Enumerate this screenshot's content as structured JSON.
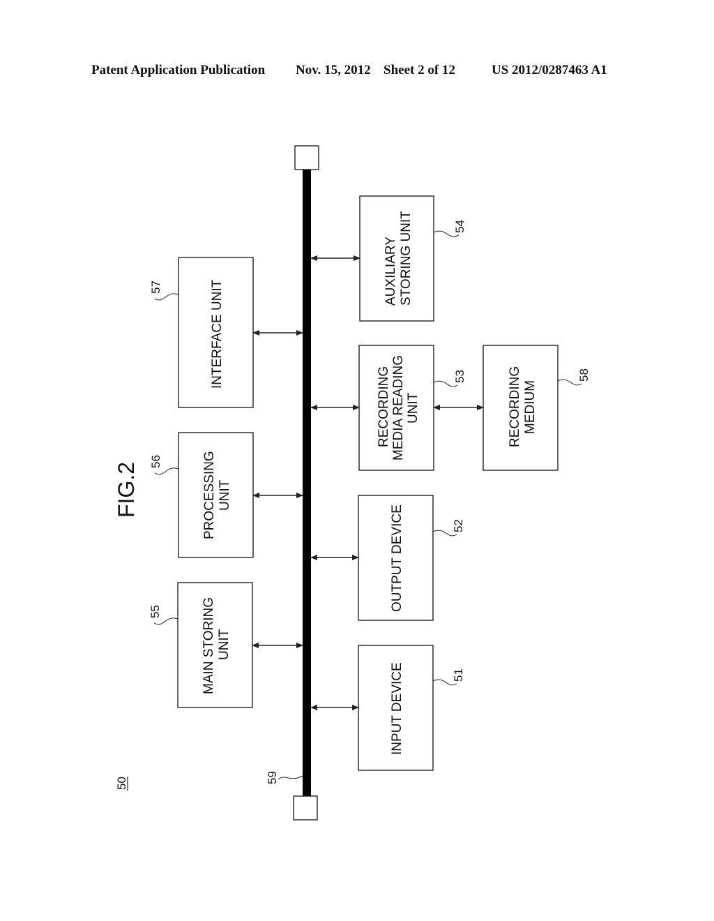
{
  "header": {
    "publication": "Patent Application Publication",
    "date": "Nov. 15, 2012",
    "sheet": "Sheet 2 of 12",
    "number": "US 2012/0287463 A1"
  },
  "figure": {
    "title": "FIG.2",
    "system_ref": "50",
    "bus_ref": "59",
    "blocks": [
      {
        "ref": "51",
        "lines": [
          "INPUT DEVICE"
        ]
      },
      {
        "ref": "52",
        "lines": [
          "OUTPUT DEVICE"
        ]
      },
      {
        "ref": "53",
        "lines": [
          "RECORDING",
          "MEDIA READING",
          "UNIT"
        ]
      },
      {
        "ref": "54",
        "lines": [
          "AUXILIARY",
          "STORING UNIT"
        ]
      },
      {
        "ref": "55",
        "lines": [
          "MAIN STORING",
          "UNIT"
        ]
      },
      {
        "ref": "56",
        "lines": [
          "PROCESSING",
          "UNIT"
        ]
      },
      {
        "ref": "57",
        "lines": [
          "INTERFACE UNIT"
        ]
      },
      {
        "ref": "58",
        "lines": [
          "RECORDING",
          "MEDIUM"
        ]
      }
    ]
  }
}
